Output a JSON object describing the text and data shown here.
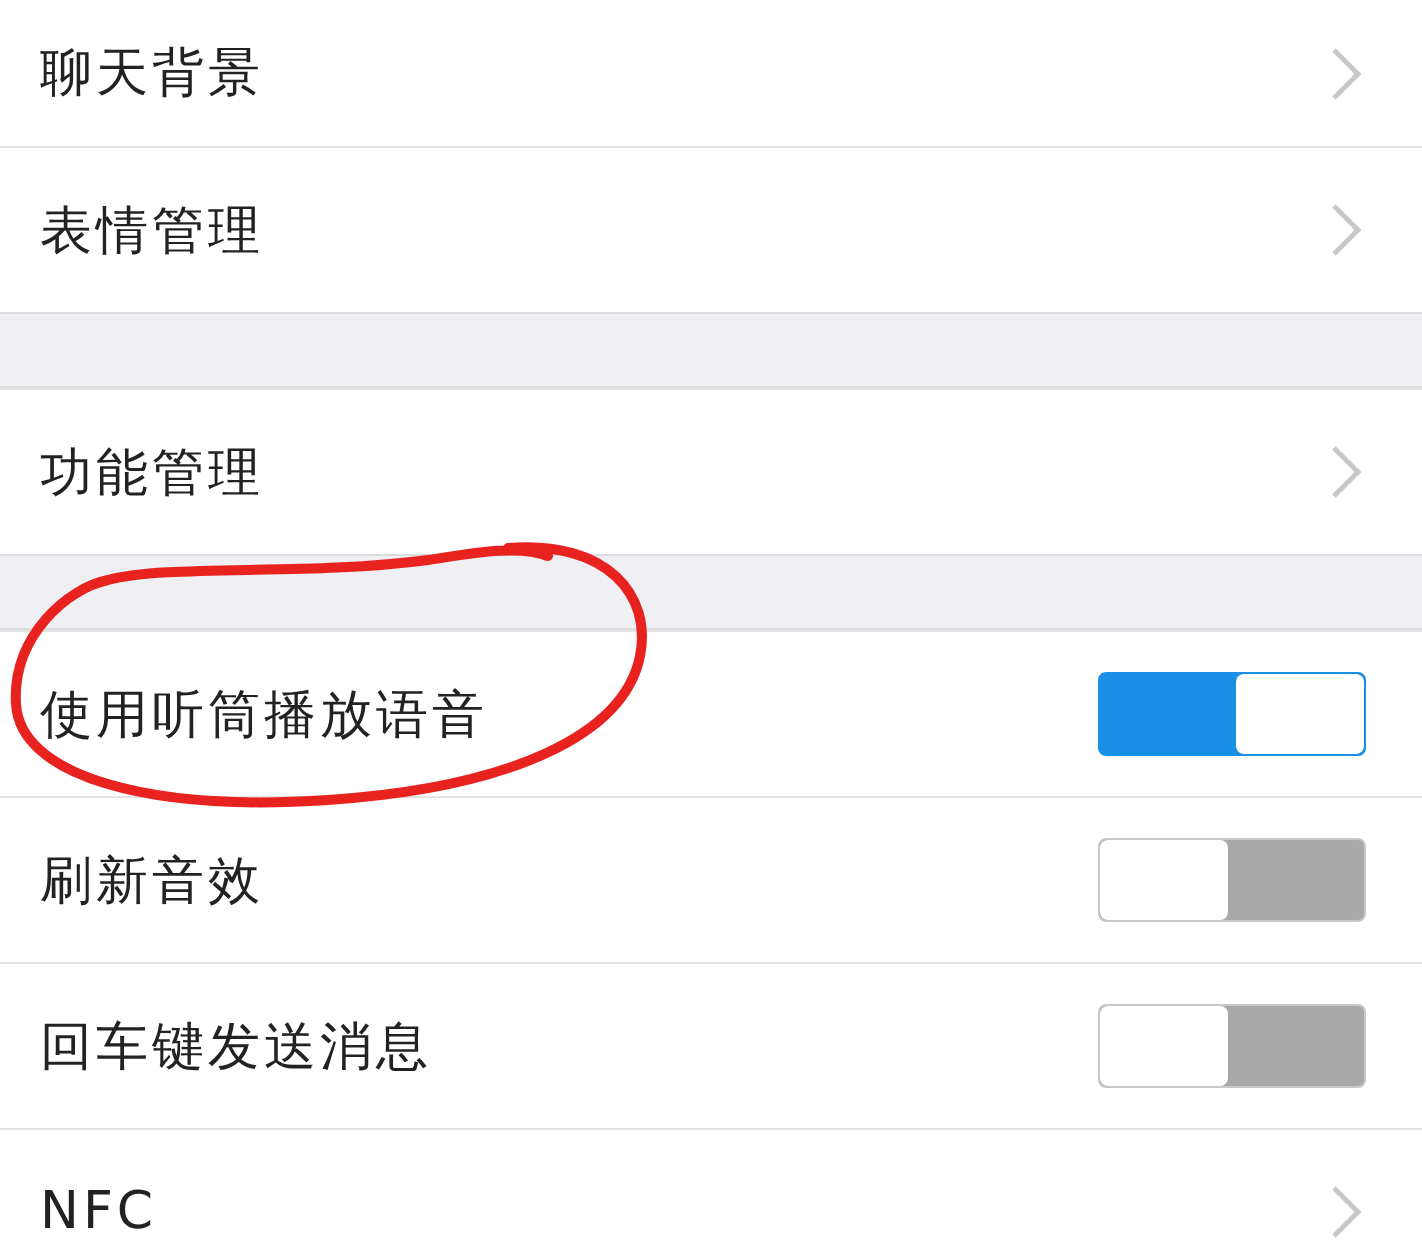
{
  "sections": [
    {
      "rows": [
        {
          "label": "聊天背景",
          "kind": "link",
          "circled": false
        },
        {
          "label": "表情管理",
          "kind": "link",
          "circled": false
        }
      ]
    },
    {
      "rows": [
        {
          "label": "功能管理",
          "kind": "link",
          "circled": false
        }
      ]
    },
    {
      "rows": [
        {
          "label": "使用听筒播放语音",
          "kind": "toggle",
          "on": true,
          "circled": true
        },
        {
          "label": "刷新音效",
          "kind": "toggle",
          "on": false,
          "circled": false
        },
        {
          "label": "回车键发送消息",
          "kind": "toggle",
          "on": false,
          "circled": false
        },
        {
          "label": "NFC",
          "kind": "link",
          "circled": false
        }
      ]
    }
  ]
}
